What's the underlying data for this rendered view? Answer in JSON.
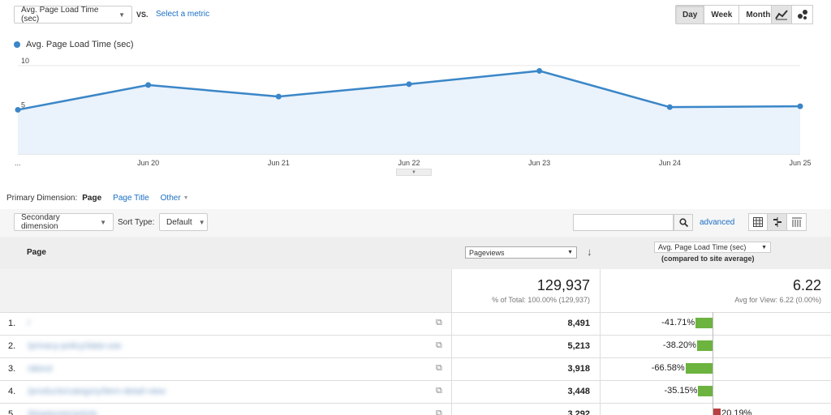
{
  "controls": {
    "metric_select": "Avg. Page Load Time (sec)",
    "vs_label": "VS.",
    "select_metric_link": "Select a metric",
    "periods": [
      "Day",
      "Week",
      "Month"
    ],
    "active_period": "Day"
  },
  "legend": {
    "series_name": "Avg. Page Load Time (sec)",
    "color": "#3a86c8"
  },
  "chart_data": {
    "type": "area",
    "x": [
      "...",
      "Jun 20",
      "Jun 21",
      "Jun 22",
      "Jun 23",
      "Jun 24",
      "Jun 25"
    ],
    "series": [
      {
        "name": "Avg. Page Load Time (sec)",
        "values": [
          5.0,
          7.8,
          6.5,
          7.9,
          9.4,
          5.3,
          5.4
        ]
      }
    ],
    "ytick_labels": [
      "10",
      "5"
    ],
    "y_ticks": [
      10,
      5
    ],
    "ylim": [
      0,
      11
    ],
    "grid": true,
    "line_color": "#3a86c8",
    "fill_color": "#eaf2fb"
  },
  "dimensions": {
    "label": "Primary Dimension:",
    "items": [
      "Page",
      "Page Title",
      "Other"
    ],
    "active": "Page"
  },
  "filters": {
    "secondary_dimension": "Secondary dimension",
    "sort_type_label": "Sort Type:",
    "sort_type_value": "Default",
    "advanced_link": "advanced"
  },
  "table": {
    "col_page": "Page",
    "col_pageviews_select": "Pageviews",
    "col_metric_select": "Avg. Page Load Time (sec)",
    "col_metric_sub": "(compared to site average)",
    "totals": {
      "pageviews": "129,937",
      "pageviews_sub": "% of Total: 100.00% (129,937)",
      "metric": "6.22",
      "metric_sub": "Avg for View: 6.22 (0.00%)"
    },
    "rows": [
      {
        "index": "1.",
        "page": "/",
        "pageviews": "8,491",
        "pct": "-41.71%",
        "pct_value": -41.71
      },
      {
        "index": "2.",
        "page": "/privacy-policy/data-use",
        "pageviews": "5,213",
        "pct": "-38.20%",
        "pct_value": -38.2
      },
      {
        "index": "3.",
        "page": "/about",
        "pageviews": "3,918",
        "pct": "-66.58%",
        "pct_value": -66.58
      },
      {
        "index": "4.",
        "page": "/products/category/item-detail-view",
        "pageviews": "3,448",
        "pct": "-35.15%",
        "pct_value": -35.15
      },
      {
        "index": "5.",
        "page": "/blog/posts/article",
        "pageviews": "3,292",
        "pct": "20.19%",
        "pct_value": 20.19
      }
    ]
  }
}
